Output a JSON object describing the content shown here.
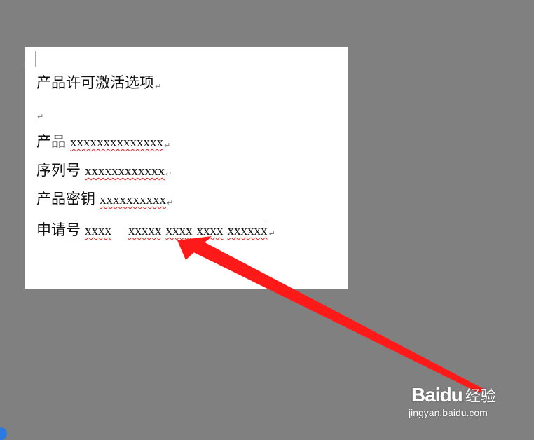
{
  "document": {
    "heading": "产品许可激活选项",
    "rows": [
      {
        "label": "产品",
        "values": [
          "xxxxxxxxxxxxxx"
        ]
      },
      {
        "label": "序列号",
        "values": [
          "xxxxxxxxxxxx"
        ]
      },
      {
        "label": "产品密钥",
        "values": [
          "xxxxxxxxxx"
        ]
      },
      {
        "label": "申请号",
        "values": [
          "xxxx",
          "xxxxx",
          "xxxx",
          "xxxx",
          "xxxxxx"
        ]
      }
    ],
    "paragraph_mark": "↵"
  },
  "watermark": {
    "brand": "Baidu",
    "suffix": "经验",
    "site": "jingyan.baidu.com"
  },
  "colors": {
    "background": "#808080",
    "page": "#ffffff",
    "arrow": "#ff1a1a",
    "spell_underline": "#e02020"
  }
}
